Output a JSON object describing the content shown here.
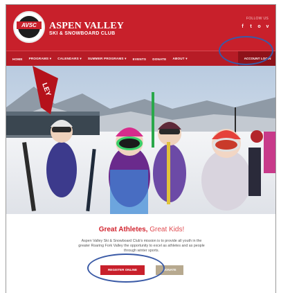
{
  "header": {
    "brand_line1": "ASPEN VALLEY",
    "brand_line2": "SKI & SNOWBOARD CLUB",
    "follow_label": "FOLLOW US",
    "socials": [
      "f",
      "t",
      "o",
      "v"
    ],
    "logo_text": "AVSC"
  },
  "nav": {
    "items": [
      "HOME",
      "PROGRAMS ▾",
      "CALENDARS ▾",
      "SUMMER PROGRAMS ▾",
      "EVENTS",
      "DONATE",
      "ABOUT ▾"
    ],
    "login": "ACCOUNT LOGIN"
  },
  "content": {
    "tagline_red": "Great Athletes,",
    "tagline_gray": " Great Kids!",
    "mission": "Aspen Valley Ski & Snowboard Club's mission is to provide all youth in the greater Roaring Fork Valley the opportunity to excel as athletes and as people through winter sports.",
    "register_label": "REGISTER ONLINE",
    "donate_label": "DONATE"
  },
  "colors": {
    "brand_red": "#c8202b",
    "nav_red": "#b71c26",
    "annotation_blue": "#3a5aa6",
    "donate_tan": "#b7a98f"
  }
}
